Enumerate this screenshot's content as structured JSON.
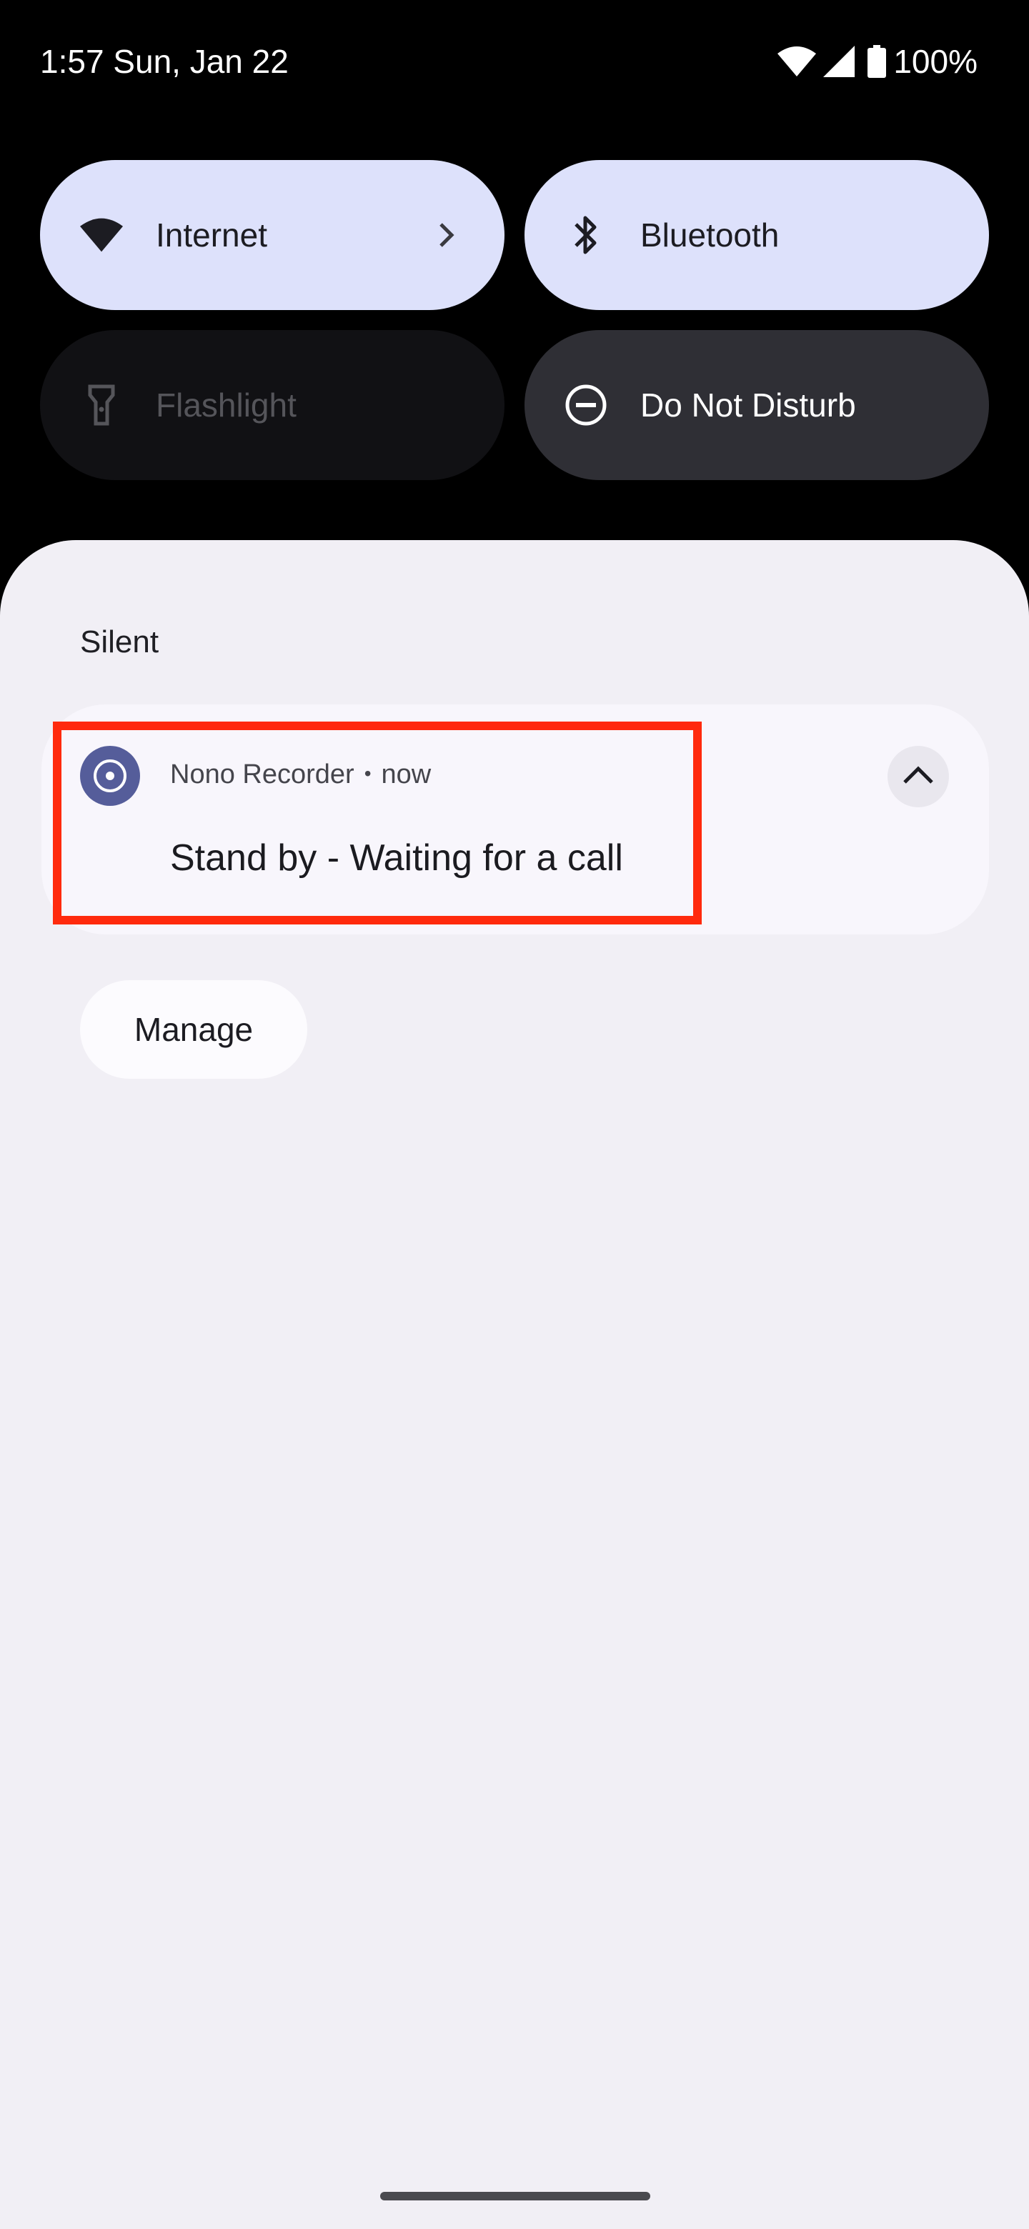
{
  "status_bar": {
    "time_date": "1:57 Sun, Jan 22",
    "battery": "100%",
    "icons": [
      "wifi-icon",
      "cell-signal-icon",
      "battery-icon"
    ]
  },
  "quick_settings": {
    "tiles": [
      {
        "label": "Internet",
        "icon": "wifi-icon",
        "state": "on",
        "has_chevron": true
      },
      {
        "label": "Bluetooth",
        "icon": "bluetooth-icon",
        "state": "on"
      },
      {
        "label": "Flashlight",
        "icon": "flashlight-icon",
        "state": "unavailable"
      },
      {
        "label": "Do Not Disturb",
        "icon": "do-not-disturb-icon",
        "state": "off"
      }
    ]
  },
  "notifications": {
    "section_label": "Silent",
    "items": [
      {
        "app_name": "Nono Recorder",
        "separator": "•",
        "time": "now",
        "text": "Stand by - Waiting for a call",
        "icon": "record-icon",
        "expanded": true
      }
    ],
    "manage_label": "Manage"
  },
  "colors": {
    "tile_on": "#dde1fb",
    "tile_off": "#2f2f35",
    "shade_bg": "#f1eff5",
    "app_icon_bg": "#555d9a",
    "highlight": "#ff2a0d"
  }
}
